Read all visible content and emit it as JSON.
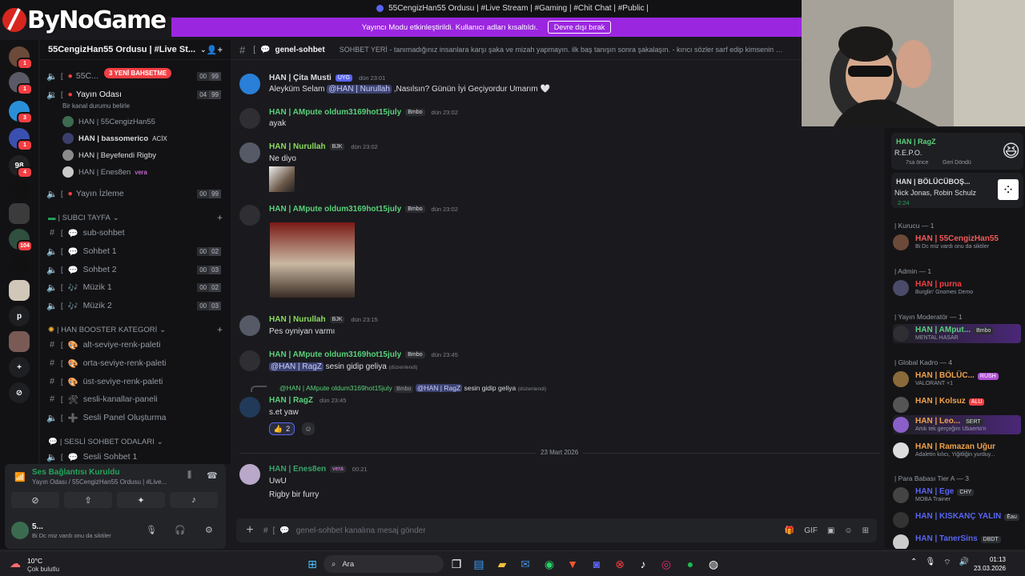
{
  "window": {
    "title": "55CengizHan55 Ordusu | #Live Stream | #Gaming | #Chit Chat | #Public |"
  },
  "logo": {
    "text": "ByNoGame"
  },
  "banner": {
    "text": "Yayıncı Modu etkinleştirildi. Kullanıcı adları kısaltıldı.",
    "button": "Devre dışı bırak"
  },
  "guild": {
    "name": "55CengizHan55 Ordusu | #Live St...",
    "new_pill": "3 YENİ BAHSETME"
  },
  "channels": {
    "voice_top": [
      {
        "name": "55C...",
        "prefix": "[",
        "c1": "00",
        "c2": "99"
      },
      {
        "name": "Yayın Odası",
        "prefix": "[",
        "c1": "04",
        "c2": "99",
        "status": "Bir kanal durumu belirle"
      }
    ],
    "voice_users": [
      {
        "name": "HAN | 55CengizHan55",
        "tag": ""
      },
      {
        "name": "HAN | bassomerico",
        "tag": "ACİX"
      },
      {
        "name": "HAN | Beyefendi Rigby",
        "tag": ""
      },
      {
        "name": "HAN | Enes8en",
        "tag": "vera"
      }
    ],
    "yayin_izleme": {
      "name": "Yayın İzleme",
      "prefix": "[",
      "c1": "00",
      "c2": "99"
    },
    "cat_subci": "| SUBCI TAYFA",
    "subci": [
      {
        "name": "sub-sohbet",
        "type": "text"
      },
      {
        "name": "Sohbet 1",
        "type": "voice",
        "c1": "00",
        "c2": "02"
      },
      {
        "name": "Sohbet 2",
        "type": "voice",
        "c1": "00",
        "c2": "03"
      },
      {
        "name": "Müzik 1",
        "type": "voice",
        "c1": "00",
        "c2": "02"
      },
      {
        "name": "Müzik 2",
        "type": "voice",
        "c1": "00",
        "c2": "03"
      }
    ],
    "cat_booster": "| HAN BOOSTER KATEGORİ",
    "booster": [
      {
        "name": "alt-seviye-renk-paleti"
      },
      {
        "name": "orta-seviye-renk-paleti"
      },
      {
        "name": "üst-seviye-renk-paleti"
      },
      {
        "name": "sesli-kanallar-paneli"
      },
      {
        "name": "Sesli Panel Oluşturma"
      }
    ],
    "cat_sesli": "| SESLİ SOHBET ODALARI",
    "sesli": [
      {
        "name": "Sesli Sohbet 1"
      }
    ]
  },
  "voice_panel": {
    "title": "Ses Bağlantısı Kuruldu",
    "subtitle": "Yayın Odası / 55CengizHan55 Ordusu | #Live...",
    "me_name": "5...",
    "me_status": "Bi Dc miz vardı onu da siktiler"
  },
  "channel_header": {
    "name": "genel-sohbet",
    "topic": "SOHBET YERİ - tanımadığınız insanlara karşı şaka ve mizah yapmayın. ilk baş tanışın sonra şakalaşın. - kırıcı sözler sarf edip kimsenin morali..."
  },
  "messages": [
    {
      "name": "HAN | Çita Musti",
      "role": "UYG",
      "time": "dün 23:01",
      "text": "Aleyküm Selam ",
      "mention": "@HAN | Nurullah",
      "text_after": " ,Nasılsın? Günün İyi Geçiyordur Umarım 🤍",
      "color": "#dbdee1"
    },
    {
      "name": "HAN | AMpute oldum3169hot15july",
      "role": "Bmbo",
      "time": "dün 23:02",
      "text": "ayak",
      "color": "#5ad17a"
    },
    {
      "name": "HAN | Nurullah",
      "role": "BJK",
      "time": "dün 23:02",
      "text": "Ne diyo",
      "color": "#8bdc5f"
    },
    {
      "name": "HAN | AMpute oldum3169hot15july",
      "role": "Bmbo",
      "time": "dün 23:02",
      "text": "",
      "color": "#5ad17a"
    },
    {
      "name": "HAN | Nurullah",
      "role": "BJK",
      "time": "dün 23:15",
      "text": "Pes oyniyan varmı",
      "color": "#8bdc5f"
    },
    {
      "name": "HAN | AMpute oldum3169hot15july",
      "role": "Bmbo",
      "time": "dün 23:45",
      "mention": "@HAN | RagZ",
      "text_after": " sesin gidip geliya",
      "edited": "(düzenlendi)",
      "color": "#5ad17a"
    },
    {
      "name": "HAN | RagZ",
      "time": "dün 23:45",
      "text": "s.et yaw",
      "color": "#5ad17a",
      "reply": {
        "name": "@HAN | AMpute oldum3169hot15july",
        "role": "Bmbo",
        "mention": "@HAN | RagZ",
        "text": " sesin gidip geliya",
        "edited": "(düzenlendi)"
      },
      "reaction": {
        "emoji": "👍",
        "count": "2"
      }
    },
    {
      "name": "HAN | Enes8en",
      "role": "vera",
      "time": "00:21",
      "text": "UwU",
      "text2": "Rigby bir furry",
      "color": "#3aa36a"
    }
  ],
  "date_divider": "23 Mart 2026",
  "composer": {
    "placeholder": "genel-sohbet kanalına mesaj gönder"
  },
  "members": {
    "activity1": {
      "name": "HAN | RagZ",
      "game": "R.E.P.O.",
      "time": "7sa önce",
      "back": "Geri Döndü"
    },
    "activity2": {
      "name": "HAN | BÖLÜCÜBOŞ...",
      "song": "Nick Jonas, Robin Schulz",
      "time": "2:24"
    },
    "groups": [
      {
        "title": "| Kurucu — 1",
        "list": [
          {
            "name": "HAN | 55CengizHan55",
            "status": "Bi Dc miz vardı onu da siktiler",
            "color": "#f25a5a"
          }
        ]
      },
      {
        "title": "| Admin — 1",
        "list": [
          {
            "name": "HAN | purna",
            "status": "Burglin' Gnomes Demo",
            "color": "#f23f43"
          }
        ]
      },
      {
        "title": "| Yayın Moderatör — 1",
        "list": [
          {
            "name": "HAN | AMput...",
            "role": "Bmbo",
            "status": "MENTAL HASAR",
            "color": "#5ad17a"
          }
        ]
      },
      {
        "title": "| Global Kadro — 4",
        "list": [
          {
            "name": "HAN | BÖLÜC...",
            "role": "RUSH",
            "status": "VALORANT +1",
            "color": "#f0a24b"
          },
          {
            "name": "HAN | Kolsuz",
            "role": "ALU",
            "status": "",
            "color": "#f0a24b"
          },
          {
            "name": "HAN | Leo...",
            "role": "SERT",
            "status": "Artık tek gerçeğim Ubaerto'n",
            "color": "#f0a24b"
          },
          {
            "name": "HAN | Ramazan Uğur",
            "status": "Adaletin kılıcı, Yiğitliğin yurduy...",
            "color": "#f0a24b"
          }
        ]
      },
      {
        "title": "| Para Babası Tier A — 3",
        "list": [
          {
            "name": "HAN | Ege",
            "role": "CHY",
            "status": "MOBA Trainer",
            "color": "#5865f2"
          },
          {
            "name": "HAN | KISKANÇ YALIN",
            "role": "Ēau",
            "status": "",
            "color": "#5865f2"
          },
          {
            "name": "HAN | TanerSins",
            "role": "DBDT",
            "status": "",
            "color": "#5865f2"
          }
        ]
      }
    ]
  },
  "taskbar": {
    "weather_temp": "10°C",
    "weather_text": "Çok bulutlu",
    "search": "Ara",
    "time": "01:13",
    "date": "23.03.2026"
  },
  "server_badges": [
    "1",
    "1",
    "3",
    "1",
    "4",
    "104"
  ],
  "server_letter": "p"
}
